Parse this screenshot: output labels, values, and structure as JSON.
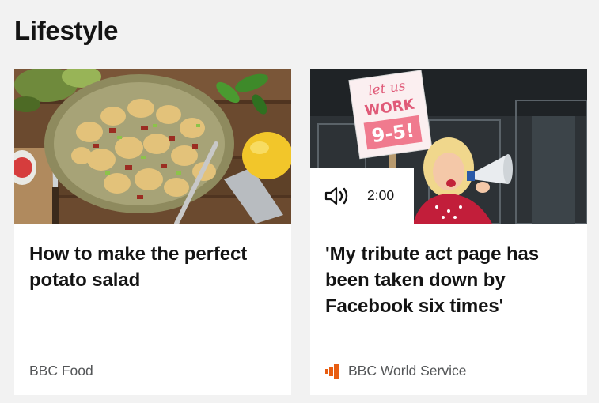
{
  "section": {
    "title": "Lifestyle"
  },
  "cards": [
    {
      "headline": "How to make the perfect potato salad",
      "source": "BBC Food",
      "image_icon": "potato-salad-photo"
    },
    {
      "headline": "'My tribute act page has been taken down by Facebook six times'",
      "source": "BBC World Service",
      "media_duration": "2:00",
      "media_icon": "speaker-icon",
      "source_icon": "world-service-logo-icon",
      "image_icon": "tribute-act-photo",
      "sign_lines": [
        "let us",
        "WORK",
        "9-5!"
      ]
    }
  ],
  "colors": {
    "background": "#f2f2f2",
    "card": "#ffffff",
    "source_text": "#545658",
    "world_service_orange": "#e85d11"
  }
}
